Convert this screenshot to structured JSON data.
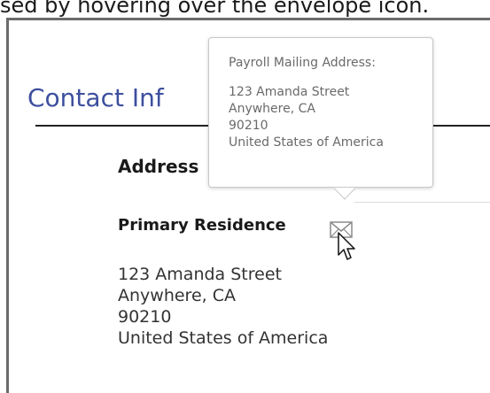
{
  "caption": "sed by hovering over the envelope icon.",
  "section": {
    "title": "Contact Inf",
    "address_heading": "Address"
  },
  "tooltip": {
    "title": "Payroll Mailing Address:",
    "lines": [
      "123 Amanda Street",
      "Anywhere, CA",
      "90210",
      "United States of America"
    ]
  },
  "residence": {
    "label": "Primary Residence",
    "lines": [
      "123 Amanda Street",
      "Anywhere, CA",
      "90210",
      "United States of America"
    ]
  },
  "icons": {
    "mail": "envelope-icon",
    "cursor": "mouse-pointer-icon"
  },
  "colors": {
    "title_blue": "#3d4f9e",
    "tooltip_text": "#6a6a6a"
  }
}
